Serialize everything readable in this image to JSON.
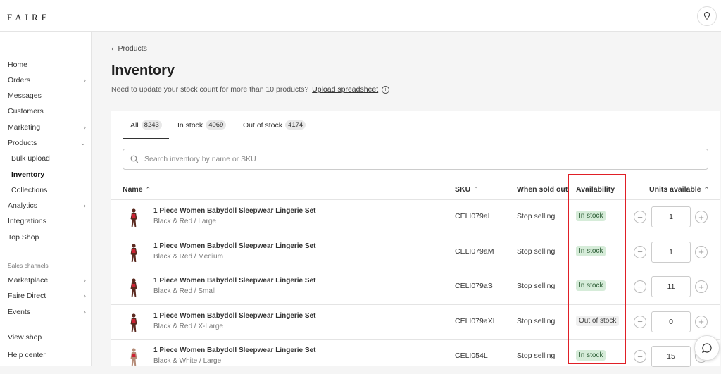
{
  "brand": {
    "logo": "FAIRE"
  },
  "sidebar": {
    "items": [
      {
        "label": "Home",
        "chevron": false
      },
      {
        "label": "Orders",
        "chevron": true
      },
      {
        "label": "Messages",
        "chevron": false
      },
      {
        "label": "Customers",
        "chevron": false
      },
      {
        "label": "Marketing",
        "chevron": true
      },
      {
        "label": "Products",
        "chevron": true,
        "expanded": true
      },
      {
        "label": "Bulk upload",
        "sub": true
      },
      {
        "label": "Inventory",
        "sub": true,
        "active": true
      },
      {
        "label": "Collections",
        "sub": true
      },
      {
        "label": "Analytics",
        "chevron": true
      },
      {
        "label": "Integrations",
        "chevron": false
      },
      {
        "label": "Top Shop",
        "chevron": false
      }
    ],
    "section_label": "Sales channels",
    "channels": [
      {
        "label": "Marketplace",
        "chevron": true
      },
      {
        "label": "Faire Direct",
        "chevron": true
      },
      {
        "label": "Events",
        "chevron": true
      }
    ],
    "footer": [
      {
        "label": "View shop"
      },
      {
        "label": "Help center"
      }
    ]
  },
  "header": {
    "breadcrumb": "Products",
    "title": "Inventory",
    "subtitle": "Need to update your stock count for more than 10 products?",
    "subtitle_link": "Upload spreadsheet"
  },
  "tabs": [
    {
      "label": "All",
      "count": "8243",
      "active": true
    },
    {
      "label": "In stock",
      "count": "4069"
    },
    {
      "label": "Out of stock",
      "count": "4174"
    }
  ],
  "search": {
    "placeholder": "Search inventory by name or SKU"
  },
  "table": {
    "columns": {
      "name": "Name",
      "sku": "SKU",
      "when": "When sold out",
      "availability": "Availability",
      "units": "Units available"
    },
    "rows": [
      {
        "name": "1 Piece Women Babydoll Sleepwear Lingerie Set",
        "variant": "Black & Red / Large",
        "sku": "CELI079aL",
        "when": "Stop selling",
        "availability": "In stock",
        "in_stock": true,
        "units": "1"
      },
      {
        "name": "1 Piece Women Babydoll Sleepwear Lingerie Set",
        "variant": "Black & Red / Medium",
        "sku": "CELI079aM",
        "when": "Stop selling",
        "availability": "In stock",
        "in_stock": true,
        "units": "1"
      },
      {
        "name": "1 Piece Women Babydoll Sleepwear Lingerie Set",
        "variant": "Black & Red / Small",
        "sku": "CELI079aS",
        "when": "Stop selling",
        "availability": "In stock",
        "in_stock": true,
        "units": "11"
      },
      {
        "name": "1 Piece Women Babydoll Sleepwear Lingerie Set",
        "variant": "Black & Red / X-Large",
        "sku": "CELI079aXL",
        "when": "Stop selling",
        "availability": "Out of stock",
        "in_stock": false,
        "units": "0"
      },
      {
        "name": "1 Piece Women Babydoll Sleepwear Lingerie Set",
        "variant": "Black & White / Large",
        "sku": "CELI054L",
        "when": "Stop selling",
        "availability": "In stock",
        "in_stock": true,
        "units": "15"
      }
    ]
  },
  "colors": {
    "highlight": "#e01f26",
    "in_stock_bg": "#d6ecd9",
    "out_stock_bg": "#f0f0f0"
  }
}
